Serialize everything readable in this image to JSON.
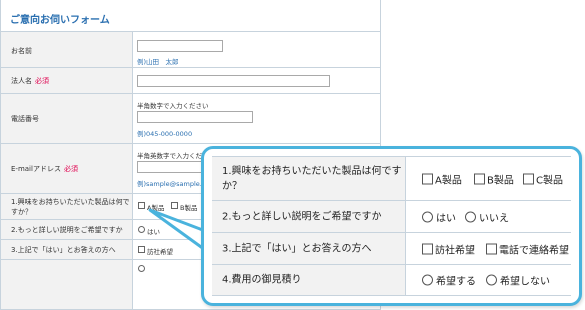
{
  "form": {
    "title": "ご意向お伺いフォーム",
    "required_mark": "必須",
    "name": {
      "label": "お名前",
      "example": "例)山田　太郎"
    },
    "company": {
      "label": "法人名"
    },
    "phone": {
      "label": "電話番号",
      "hint": "半角数字で入力ください",
      "example": "例)045-000-0000"
    },
    "email": {
      "label": "E-mailアドレス",
      "hint": "半角英数字で入力ください",
      "example": "例)sample@sample.com"
    },
    "q1": {
      "label_line1": "1.興味をお持ちいただいた製品は何で",
      "label_line2": "すか？",
      "opt_a": "A製品",
      "opt_b": "B製品"
    },
    "q2": {
      "label": "2.もっと詳しい説明をご希望ですか",
      "opt_yes": "はい"
    },
    "q3": {
      "label": "3.上記で「はい」とお答えの方へ",
      "opt_visit": "訪社希望"
    }
  },
  "callout": {
    "q1": {
      "label": "1.興味をお持ちいただいた製品は何ですか？",
      "options": [
        "A製品",
        "B製品",
        "C製品"
      ]
    },
    "q2": {
      "label": "2.もっと詳しい説明をご希望ですか",
      "options": [
        "はい",
        "いいえ"
      ]
    },
    "q3": {
      "label": "3.上記で「はい」とお答えの方へ",
      "options": [
        "訪社希望",
        "電話で連絡希望"
      ]
    },
    "q4": {
      "label": "4.費用の御見積り",
      "options": [
        "希望する",
        "希望しない"
      ]
    }
  },
  "colors": {
    "accent": "#4ab3dd",
    "title": "#2a6fb0",
    "required": "#e0004e",
    "label_bg": "#f2f2f2",
    "border": "#c7d3dd"
  }
}
